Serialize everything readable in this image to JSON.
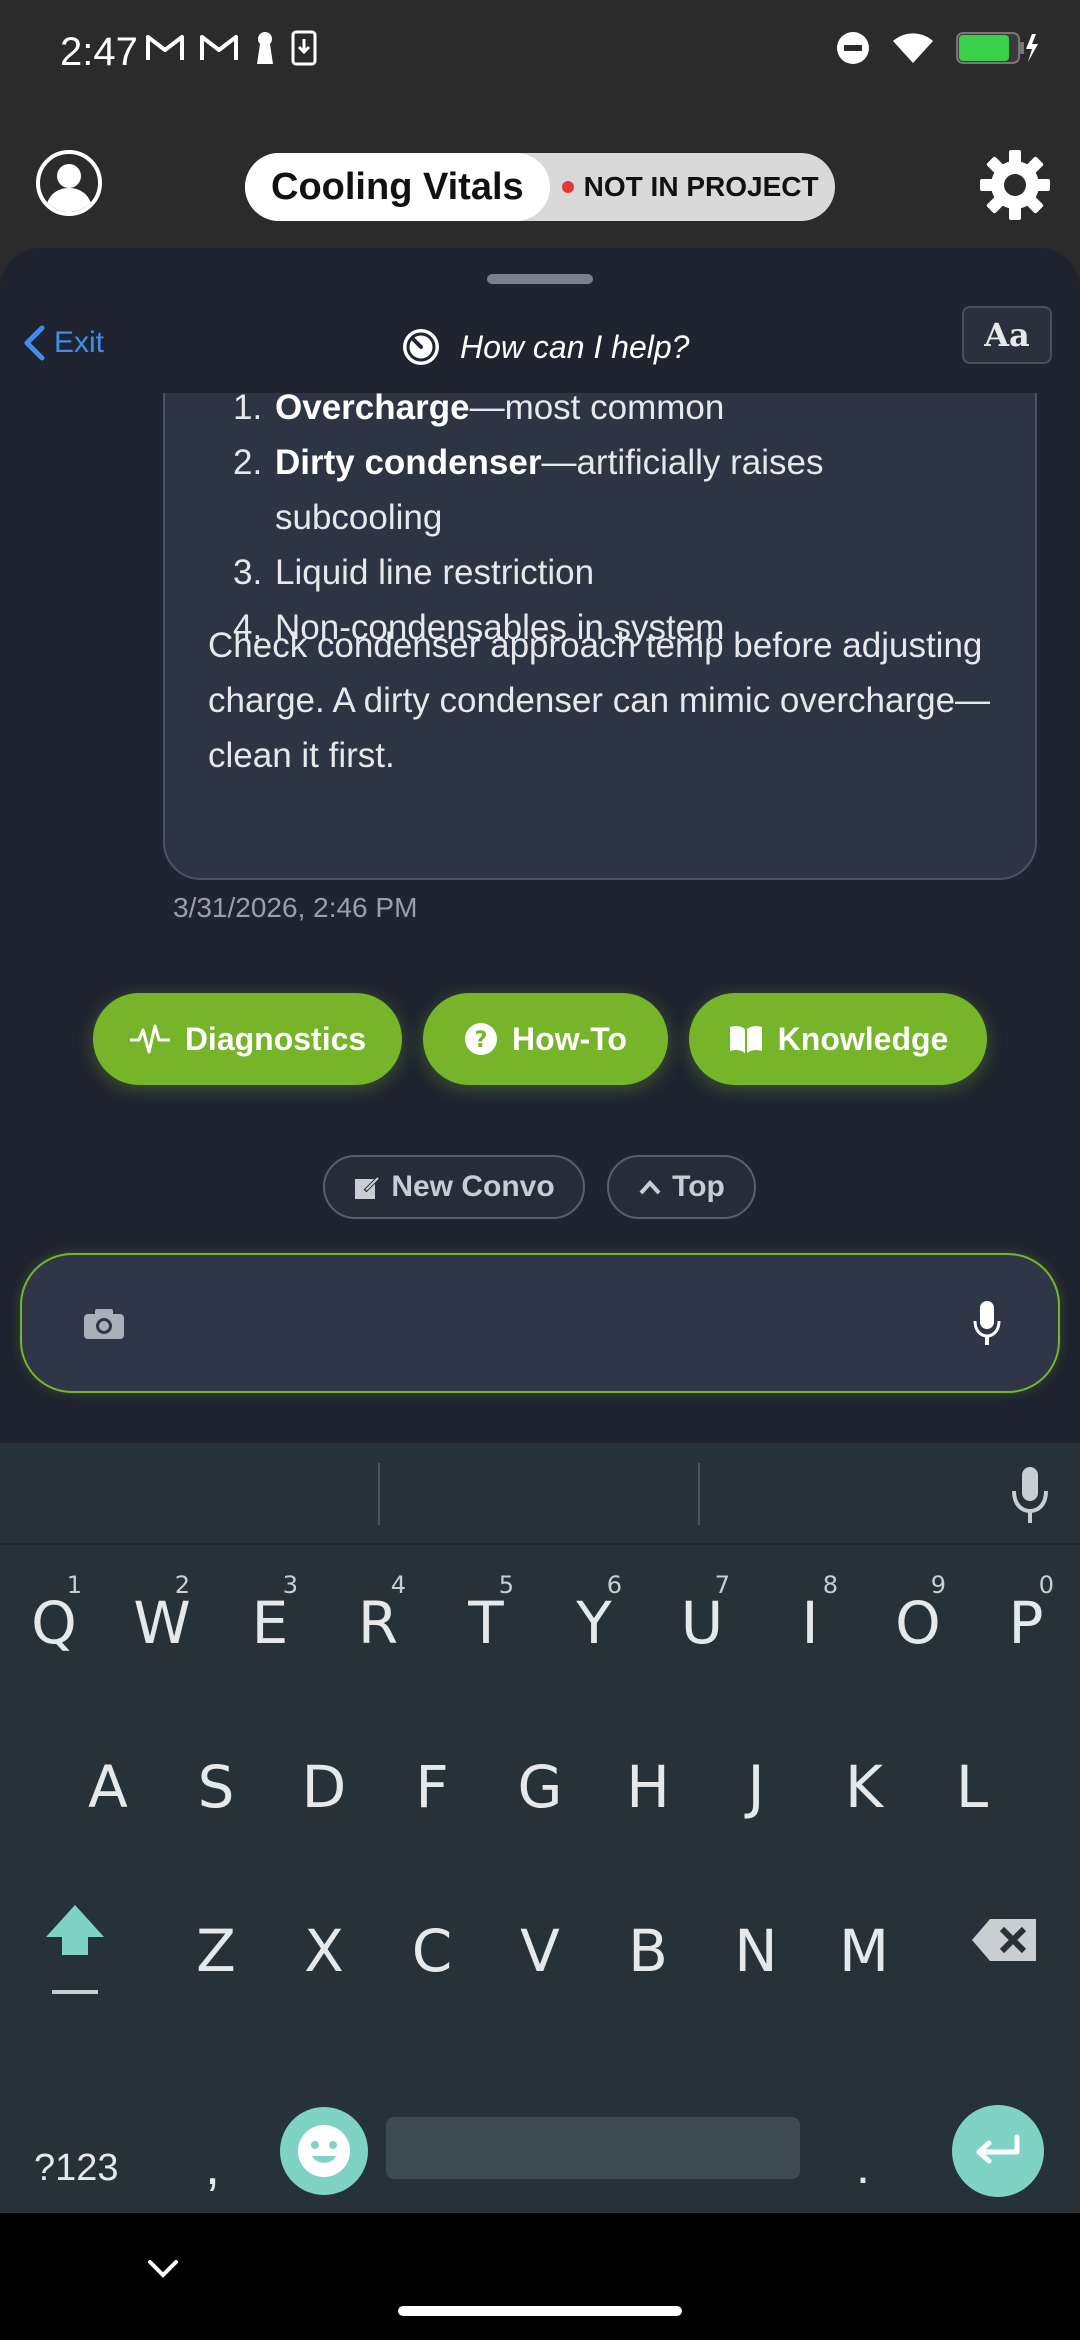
{
  "status_bar": {
    "time": "2:47",
    "left_icons": [
      "gmail-icon",
      "gmail-icon",
      "keyhole-icon",
      "download-phone-icon"
    ],
    "right_icons": [
      "do-not-disturb-icon",
      "wifi-icon",
      "battery-charging-icon"
    ]
  },
  "header": {
    "project_name": "Cooling Vitals",
    "project_status": "NOT IN PROJECT",
    "status_color": "#e53935"
  },
  "chat_header": {
    "exit_label": "Exit",
    "title": "How can I help?",
    "font_button_label": "Aa"
  },
  "message": {
    "list": [
      {
        "num": "1.",
        "bold": "Overcharge",
        "rest": "—most common"
      },
      {
        "num": "2.",
        "bold": "Dirty condenser",
        "rest": "—artificially raises subcooling"
      },
      {
        "num": "3.",
        "bold": "",
        "rest": "Liquid line restriction"
      },
      {
        "num": "4.",
        "bold": "",
        "rest": "Non-condensables in system"
      }
    ],
    "paragraph": "Check condenser approach temp before adjusting charge. A dirty condenser can mimic overcharge—clean it first.",
    "timestamp": "3/31/2026, 2:46 PM"
  },
  "quick_actions": {
    "diagnostics": "Diagnostics",
    "howto": "How-To",
    "knowledge": "Knowledge",
    "accent_color": "#76b52a"
  },
  "convo_actions": {
    "new_convo": "New Convo",
    "top": "Top"
  },
  "composer": {
    "placeholder": ""
  },
  "keyboard": {
    "row1": [
      {
        "k": "Q",
        "alt": "1"
      },
      {
        "k": "W",
        "alt": "2"
      },
      {
        "k": "E",
        "alt": "3"
      },
      {
        "k": "R",
        "alt": "4"
      },
      {
        "k": "T",
        "alt": "5"
      },
      {
        "k": "Y",
        "alt": "6"
      },
      {
        "k": "U",
        "alt": "7"
      },
      {
        "k": "I",
        "alt": "8"
      },
      {
        "k": "O",
        "alt": "9"
      },
      {
        "k": "P",
        "alt": "0"
      }
    ],
    "row2": [
      "A",
      "S",
      "D",
      "F",
      "G",
      "H",
      "J",
      "K",
      "L"
    ],
    "row3": [
      "Z",
      "X",
      "C",
      "V",
      "B",
      "N",
      "M"
    ],
    "symbols_label": "?123",
    "comma": ",",
    "period": ".",
    "accent_color": "#7ed3c5"
  }
}
